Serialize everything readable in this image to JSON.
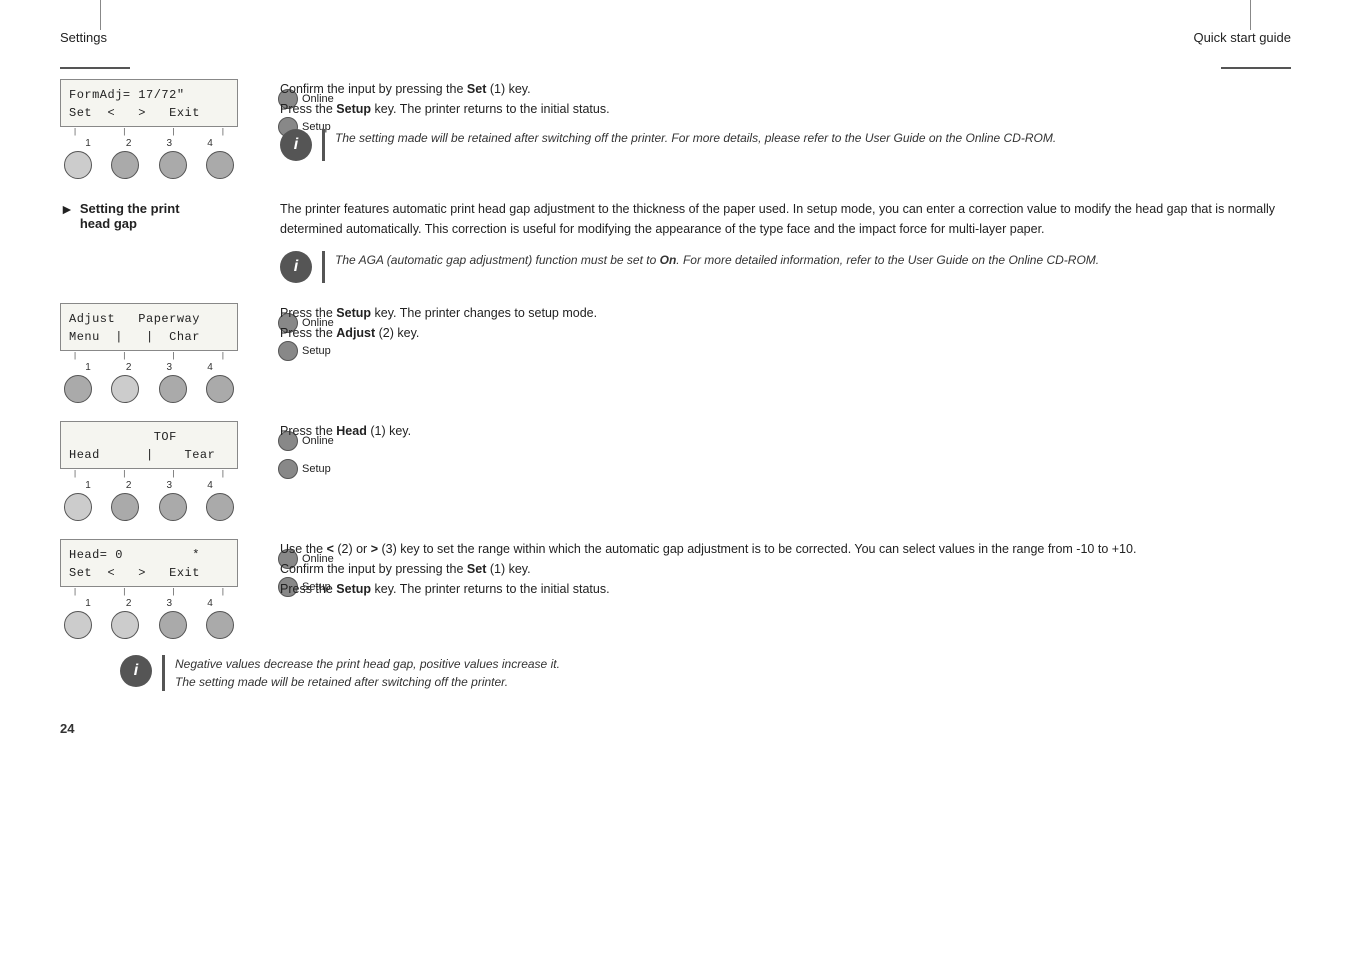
{
  "header": {
    "left": "Settings",
    "right": "Quick start guide"
  },
  "footer": {
    "page_number": "24"
  },
  "top_section": {
    "lcd1": {
      "line1": "FormAdj= 17/72\"",
      "line2": "Set  <   >   Exit",
      "numbers": [
        "1",
        "2",
        "3",
        "4"
      ]
    },
    "side_buttons": [
      "Online",
      "Setup"
    ],
    "text1": "Confirm the input by pressing the ",
    "text1_bold": "Set",
    "text1_rest": " (1) key.",
    "text2": "Press the ",
    "text2_bold": "Setup",
    "text2_rest": " key. The printer returns to the initial status.",
    "info_italic": "The setting made will be retained after switching off the printer. For more details, please refer to the User Guide on the Online CD-ROM."
  },
  "main_heading": {
    "arrow": "►",
    "label_line1": "Setting the print",
    "label_line2": "head gap"
  },
  "main_text": "The printer features automatic print head gap adjustment to the thickness of the paper used. In setup mode, you can enter a correction value to modify the head gap that is normally determined automatically. This correction is useful for modifying the appearance of the type face and the impact force for multi-layer paper.",
  "info_box1": {
    "italic": "The AGA (automatic gap adjustment) function must be set to ",
    "bold_italic": "On",
    "italic2": ". For more detailed information, refer to the User Guide on the Online CD-ROM."
  },
  "sub1": {
    "lcd": {
      "line1": "Adjust   Paperway",
      "line2": "Menu  |   |  Char",
      "numbers": [
        "1",
        "2",
        "3",
        "4"
      ]
    },
    "side_buttons": [
      "Online",
      "Setup"
    ],
    "text": "Press the ",
    "text_bold": "Setup",
    "text_rest": " key. The printer changes to setup mode.",
    "text2": "Press the ",
    "text2_bold": "Adjust",
    "text2_rest": " (2) key."
  },
  "sub2": {
    "lcd": {
      "line1": "           TOF",
      "line2": "Head      |    Tear",
      "numbers": [
        "1",
        "2",
        "3",
        "4"
      ]
    },
    "side_buttons": [
      "Online",
      "Setup"
    ],
    "text": "Press the ",
    "text_bold": "Head",
    "text_rest": " (1) key."
  },
  "sub3": {
    "lcd": {
      "line1": "Head= 0         *",
      "line2": "Set  <   >   Exit",
      "numbers": [
        "1",
        "2",
        "3",
        "4"
      ]
    },
    "side_buttons": [
      "Online",
      "Setup"
    ],
    "text1": "Use the < (2) or > (3) key to set the range within which the automatic gap adjustment is to be corrected. You can select values in the range from -10 to +10.",
    "text2": "Confirm the input by pressing the ",
    "text2_bold": "Set",
    "text2_rest": " (1) key.",
    "text3": "Press the ",
    "text3_bold": "Setup",
    "text3_rest": " key. The printer returns to the initial status."
  },
  "info_box2": {
    "italic1": "Negative values decrease the print head gap, positive values increase it.",
    "italic2": "The setting made will be retained after switching off the printer."
  }
}
